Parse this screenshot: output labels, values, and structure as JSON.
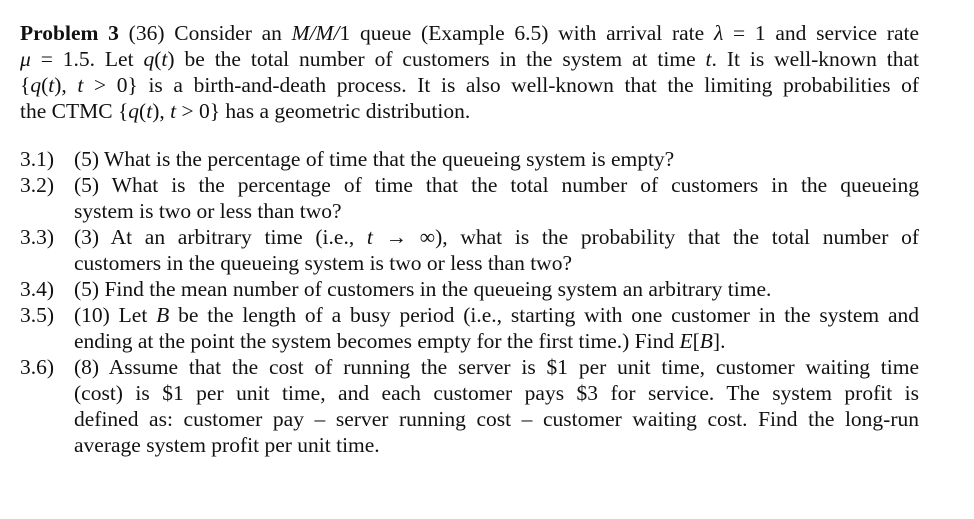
{
  "problem": {
    "label": "Problem 3",
    "points": "(36)",
    "intro_lines": [
      [
        {
          "t": " Consider an "
        },
        {
          "t": "M/M/",
          "i": true
        },
        {
          "t": "1 queue (Example 6.5) with arrival rate "
        },
        {
          "t": "λ",
          "i": true
        },
        {
          "t": " = 1 and service rate"
        }
      ],
      [
        {
          "t": "μ",
          "i": true
        },
        {
          "t": " = 1.5.  Let "
        },
        {
          "t": "q",
          "i": true
        },
        {
          "t": "("
        },
        {
          "t": "t",
          "i": true
        },
        {
          "t": ") be the total number of customers in the system at time "
        },
        {
          "t": "t",
          "i": true
        },
        {
          "t": ".  It is well-known that"
        }
      ],
      [
        {
          "t": "{"
        },
        {
          "t": "q",
          "i": true
        },
        {
          "t": "("
        },
        {
          "t": "t",
          "i": true
        },
        {
          "t": "), "
        },
        {
          "t": "t",
          "i": true
        },
        {
          "t": " > 0} is a birth-and-death process.  It is also well-known that the limiting probabilities of"
        }
      ],
      [
        {
          "t": "the CTMC {"
        },
        {
          "t": "q",
          "i": true
        },
        {
          "t": "("
        },
        {
          "t": "t",
          "i": true
        },
        {
          "t": "), "
        },
        {
          "t": "t",
          "i": true
        },
        {
          "t": " > 0} has a geometric distribution."
        }
      ]
    ]
  },
  "items": [
    {
      "number": "3.1)",
      "lines": [
        [
          {
            "t": "(5) What is the percentage of time that the queueing system is empty?"
          }
        ]
      ]
    },
    {
      "number": "3.2)",
      "lines": [
        [
          {
            "t": "(5) What is the percentage of time that the total number of customers in the queueing"
          }
        ],
        [
          {
            "t": "system is two or less than two?"
          }
        ]
      ]
    },
    {
      "number": "3.3)",
      "lines": [
        [
          {
            "t": "(3) At an arbitrary time (i.e., "
          },
          {
            "t": "t",
            "i": true
          },
          {
            "t": " → ∞), what is the probability that the total number of"
          }
        ],
        [
          {
            "t": "customers in the queueing system is two or less than two?"
          }
        ]
      ]
    },
    {
      "number": "3.4)",
      "lines": [
        [
          {
            "t": "(5) Find the mean number of customers in the queueing system an arbitrary time."
          }
        ]
      ]
    },
    {
      "number": "3.5)",
      "lines": [
        [
          {
            "t": "(10) Let "
          },
          {
            "t": "B",
            "i": true
          },
          {
            "t": " be the length of a busy period (i.e., starting with one customer in the system and"
          }
        ],
        [
          {
            "t": "ending at the point the system becomes empty for the first time.)  Find "
          },
          {
            "t": "E",
            "i": true
          },
          {
            "t": "["
          },
          {
            "t": "B",
            "i": true
          },
          {
            "t": "]."
          }
        ]
      ]
    },
    {
      "number": "3.6)",
      "lines": [
        [
          {
            "t": "(8) Assume that the cost of running the server is $1 per unit time, customer waiting time"
          }
        ],
        [
          {
            "t": "(cost) is $1 per unit time, and each customer pays $3 for service.  The system profit is"
          }
        ],
        [
          {
            "t": "defined as: customer pay – server running cost – customer waiting cost.  Find the long-run"
          }
        ],
        [
          {
            "t": "average system profit per unit time."
          }
        ]
      ]
    }
  ]
}
